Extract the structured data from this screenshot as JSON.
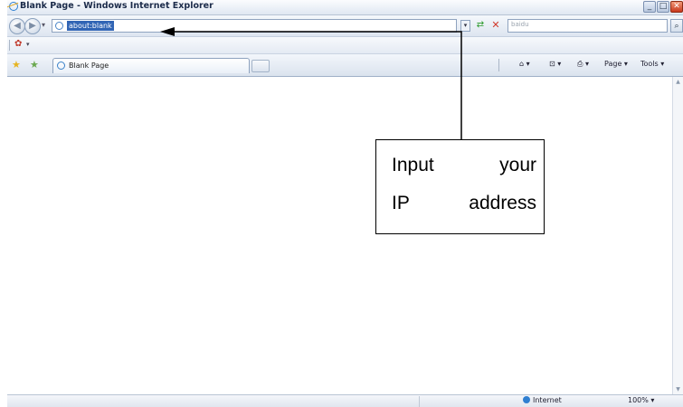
{
  "window": {
    "title": "Blank Page - Windows Internet Explorer",
    "buttons": [
      "_",
      "□",
      "✕"
    ]
  },
  "nav": {
    "back_glyph": "◀",
    "forward_glyph": "▶",
    "history_glyph": "▾",
    "address": "about:blank",
    "address_drop_glyph": "▾",
    "refresh_glyph": "⇄",
    "stop_glyph": "✕",
    "search_value": "baidu",
    "search_glyph": "⌕"
  },
  "links": {
    "addon_glyph": "✿",
    "addon_drop": "▾"
  },
  "tabs": {
    "favorites_glyph": "★",
    "add_favorite_glyph": "★",
    "active_tab_label": "Blank Page"
  },
  "command_bar": {
    "home": "⌂ ▾",
    "feeds": "⊡ ▾",
    "print": "⎙ ▾",
    "page": "Page ▾",
    "tools": "Tools ▾"
  },
  "status": {
    "zone": "Internet",
    "zoom": "100%",
    "zoom_drop": "▾"
  },
  "annotation": {
    "line1_a": "Input",
    "line1_b": "your",
    "line2_a": "IP",
    "line2_b": "address"
  },
  "colors": {
    "selection": "#3165b5",
    "title_text": "#1b2b4a",
    "annotation_border": "#000000"
  }
}
